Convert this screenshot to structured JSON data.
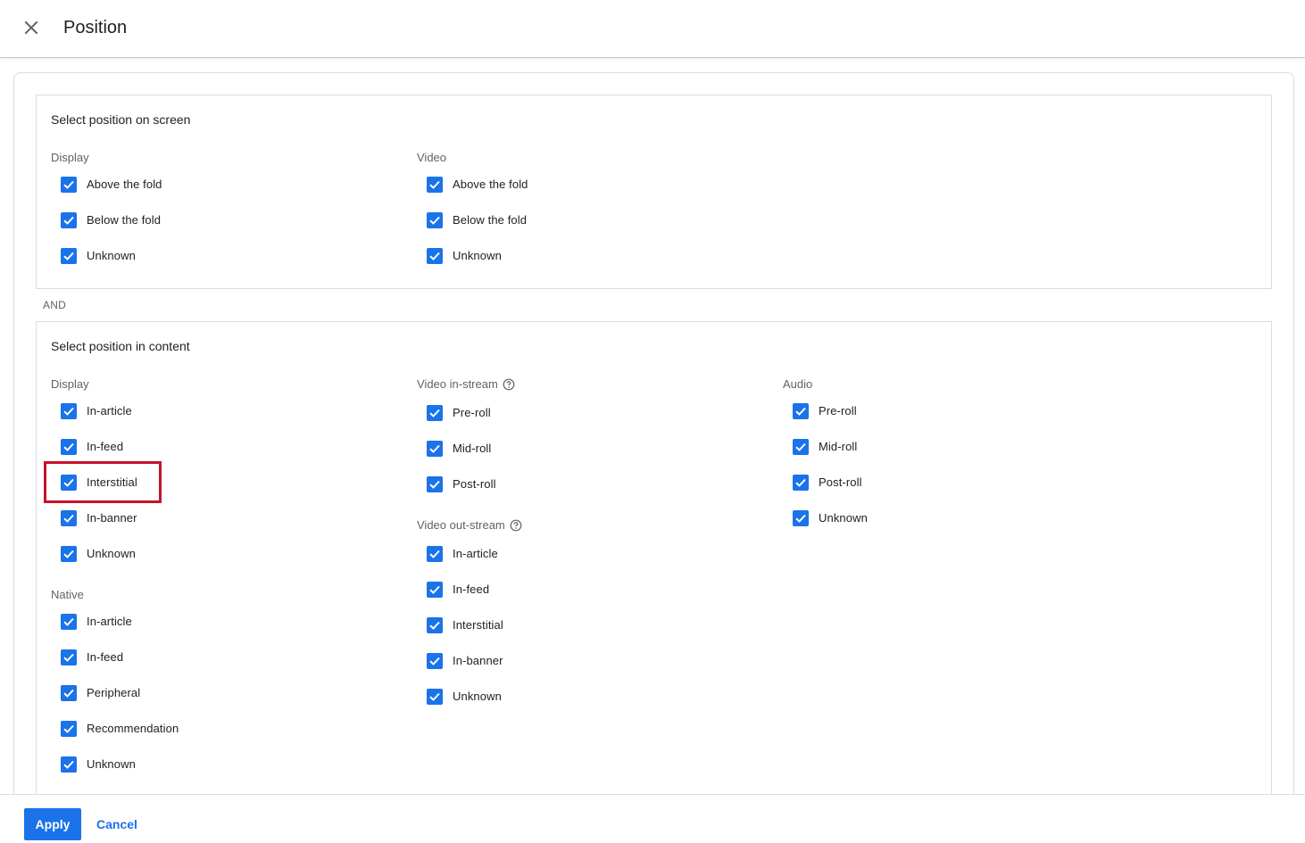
{
  "header": {
    "title": "Position",
    "close_icon": "close-icon"
  },
  "screen": {
    "title": "Select position on screen",
    "display": {
      "label": "Display",
      "items": [
        "Above the fold",
        "Below the fold",
        "Unknown"
      ]
    },
    "video": {
      "label": "Video",
      "items": [
        "Above the fold",
        "Below the fold",
        "Unknown"
      ]
    }
  },
  "and_label": "AND",
  "content": {
    "title": "Select position in content",
    "display": {
      "label": "Display",
      "items": [
        "In-article",
        "In-feed",
        "Interstitial",
        "In-banner",
        "Unknown"
      ]
    },
    "native": {
      "label": "Native",
      "items": [
        "In-article",
        "In-feed",
        "Peripheral",
        "Recommendation",
        "Unknown"
      ]
    },
    "video_instream": {
      "label": "Video in-stream",
      "items": [
        "Pre-roll",
        "Mid-roll",
        "Post-roll"
      ]
    },
    "video_outstream": {
      "label": "Video out-stream",
      "items": [
        "In-article",
        "In-feed",
        "Interstitial",
        "In-banner",
        "Unknown"
      ]
    },
    "audio": {
      "label": "Audio",
      "items": [
        "Pre-roll",
        "Mid-roll",
        "Post-roll",
        "Unknown"
      ]
    }
  },
  "footer": {
    "apply_label": "Apply",
    "cancel_label": "Cancel"
  },
  "colors": {
    "accent": "#1a73e8",
    "highlight": "#c8102e"
  }
}
